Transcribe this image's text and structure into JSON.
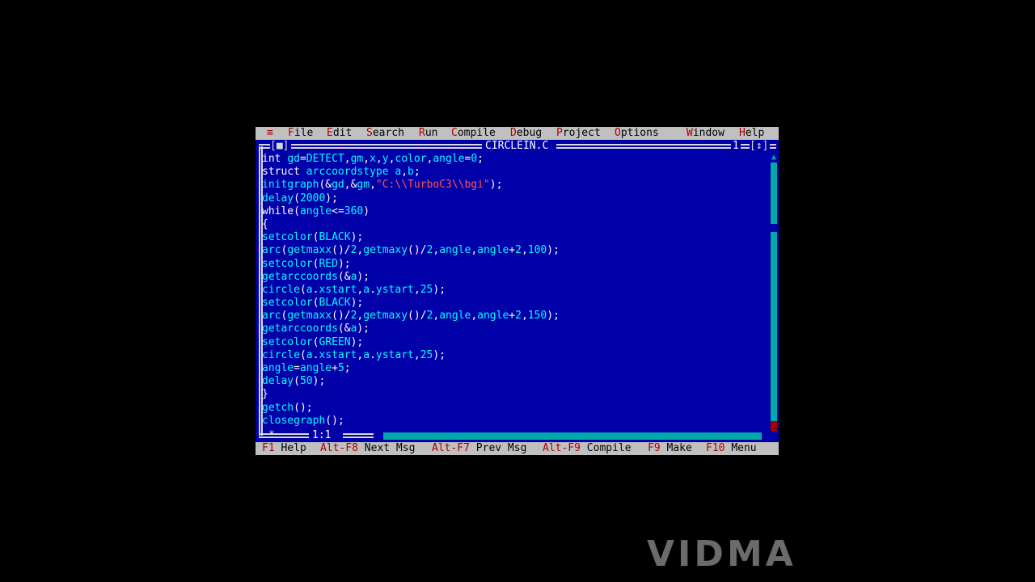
{
  "menu": {
    "system": "≡",
    "items": [
      {
        "hotkey": "F",
        "rest": "ile"
      },
      {
        "hotkey": "E",
        "rest": "dit"
      },
      {
        "hotkey": "S",
        "rest": "earch"
      },
      {
        "hotkey": "R",
        "rest": "un"
      },
      {
        "hotkey": "C",
        "rest": "ompile"
      },
      {
        "hotkey": "D",
        "rest": "ebug"
      },
      {
        "hotkey": "P",
        "rest": "roject"
      },
      {
        "hotkey": "O",
        "rest": "ptions"
      },
      {
        "hotkey": "W",
        "rest": "indow"
      },
      {
        "hotkey": "H",
        "rest": "elp"
      }
    ]
  },
  "window": {
    "close_box": "[■]",
    "title": "CIRCLEIN.C",
    "number": "1",
    "zoom_box": "[↕]",
    "cursor_position": "1:1",
    "modified_marker": "*"
  },
  "code_lines": [
    "int gd=DETECT,gm,x,y,color,angle=0;",
    "struct arccoordstype a,b;",
    "initgraph(&gd,&gm,\"C:\\\\TurboC3\\\\bgi\");",
    "delay(2000);",
    "while(angle<=360)",
    "{",
    "setcolor(BLACK);",
    "arc(getmaxx()/2,getmaxy()/2,angle,angle+2,100);",
    "setcolor(RED);",
    "getarccoords(&a);",
    "circle(a.xstart,a.ystart,25);",
    "setcolor(BLACK);",
    "arc(getmaxx()/2,getmaxy()/2,angle,angle+2,150);",
    "getarccoords(&a);",
    "setcolor(GREEN);",
    "circle(a.xstart,a.ystart,25);",
    "angle=angle+5;",
    "delay(50);",
    "}",
    "getch();",
    "closegraph();"
  ],
  "status": [
    {
      "key": "F1",
      "label": "Help"
    },
    {
      "key": "Alt-F8",
      "label": "Next Msg"
    },
    {
      "key": "Alt-F7",
      "label": "Prev Msg"
    },
    {
      "key": "Alt-F9",
      "label": "Compile"
    },
    {
      "key": "F9",
      "label": "Make"
    },
    {
      "key": "F10",
      "label": "Menu"
    }
  ],
  "watermark": "VIDMA",
  "colors": {
    "background": "#0000a8",
    "menu_bar": "#c0c0c0",
    "hotkey": "#a80000",
    "keyword": "#ffffff",
    "identifier": "#00ffff",
    "string": "#ff5555",
    "scrollbar": "#00a8a8"
  }
}
